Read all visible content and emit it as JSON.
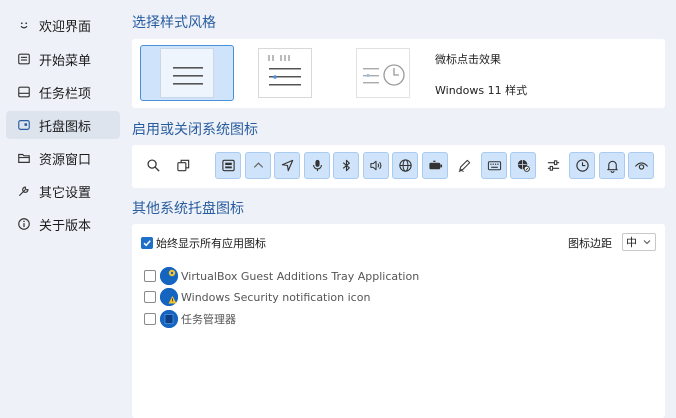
{
  "sidebar": {
    "items": [
      {
        "label": "欢迎界面",
        "icon": "smiley-icon"
      },
      {
        "label": "开始菜单",
        "icon": "start-menu-icon"
      },
      {
        "label": "任务栏项",
        "icon": "taskbar-icon"
      },
      {
        "label": "托盘图标",
        "icon": "tray-icon"
      },
      {
        "label": "资源窗口",
        "icon": "folder-icon"
      },
      {
        "label": "其它设置",
        "icon": "wrench-icon"
      },
      {
        "label": "关于版本",
        "icon": "info-icon"
      }
    ],
    "active_index": 3
  },
  "style_section": {
    "title": "选择样式风格",
    "options": [
      "style-classic",
      "style-ruler",
      "style-clock"
    ],
    "selected_index": 0,
    "label_effect": "微标点击效果",
    "label_win11": "Windows 11 样式"
  },
  "system_icons_section": {
    "title": "启用或关闭系统图标",
    "icons": [
      {
        "name": "search-icon",
        "on": false
      },
      {
        "name": "task-view-icon",
        "on": false
      },
      {
        "name": "widgets-icon",
        "on": true
      },
      {
        "name": "chevron-up-icon",
        "on": true
      },
      {
        "name": "location-icon",
        "on": true
      },
      {
        "name": "microphone-icon",
        "on": true
      },
      {
        "name": "bluetooth-icon",
        "on": true
      },
      {
        "name": "volume-icon",
        "on": true
      },
      {
        "name": "globe-icon",
        "on": true
      },
      {
        "name": "battery-icon",
        "on": true
      },
      {
        "name": "pen-icon",
        "on": false
      },
      {
        "name": "keyboard-icon",
        "on": true
      },
      {
        "name": "network-globe-icon",
        "on": true
      },
      {
        "name": "sliders-icon",
        "on": false
      },
      {
        "name": "clock-icon",
        "on": true
      },
      {
        "name": "bell-icon",
        "on": true
      },
      {
        "name": "eye-icon",
        "on": true
      }
    ]
  },
  "other_section": {
    "title": "其他系统托盘图标",
    "always_show_label": "始终显示所有应用图标",
    "always_show_checked": true,
    "margin_label": "图标边距",
    "margin_value": "中",
    "apps": [
      {
        "label": "VirtualBox Guest Additions Tray Application",
        "checked": false,
        "badge": "gear"
      },
      {
        "label": "Windows Security notification icon",
        "checked": false,
        "badge": "warning"
      },
      {
        "label": "任务管理器",
        "checked": false,
        "badge": "none"
      }
    ]
  },
  "colors": {
    "accent": "#2a5d9f",
    "selected_bg": "#cfe4fa",
    "window_bg": "#eef2f8"
  }
}
